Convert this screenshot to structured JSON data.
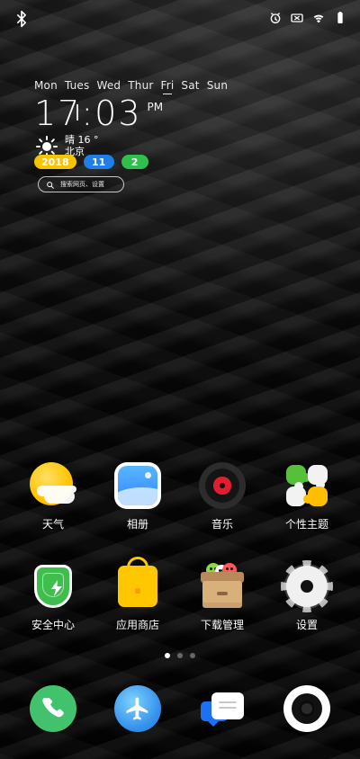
{
  "status_bar": {
    "left_icons": [
      "bluetooth-icon"
    ],
    "right_icons": [
      "alarm-icon",
      "sim-off-icon",
      "wifi-icon",
      "battery-icon"
    ]
  },
  "widget": {
    "days": [
      "Mon",
      "Tues",
      "Wed",
      "Thur",
      "Fri",
      "Sat",
      "Sun"
    ],
    "selected_day": "Fri",
    "time": "17:03",
    "ampm": "PM",
    "weather": {
      "condition": "晴",
      "temp": "16 °",
      "city": "北京"
    },
    "date": {
      "year": "2018",
      "month": "11",
      "day": "2"
    },
    "search_text": "搜索网页、设置"
  },
  "apps": [
    {
      "label": "天气",
      "icon": "weather-icon"
    },
    {
      "label": "相册",
      "icon": "photos-icon"
    },
    {
      "label": "音乐",
      "icon": "music-icon"
    },
    {
      "label": "个性主题",
      "icon": "themes-icon"
    },
    {
      "label": "安全中心",
      "icon": "security-icon"
    },
    {
      "label": "应用商店",
      "icon": "appstore-icon"
    },
    {
      "label": "下载管理",
      "icon": "downloads-icon"
    },
    {
      "label": "设置",
      "icon": "settings-icon"
    }
  ],
  "page_indicator": {
    "count": 3,
    "active_index": 0
  },
  "dock": [
    {
      "icon": "phone-icon"
    },
    {
      "icon": "browser-icon"
    },
    {
      "icon": "messages-icon"
    },
    {
      "icon": "camera-icon"
    }
  ],
  "colors": {
    "year_pill": "#f7c400",
    "month_pill": "#1f7ee8",
    "day_pill": "#2fbf4d"
  }
}
